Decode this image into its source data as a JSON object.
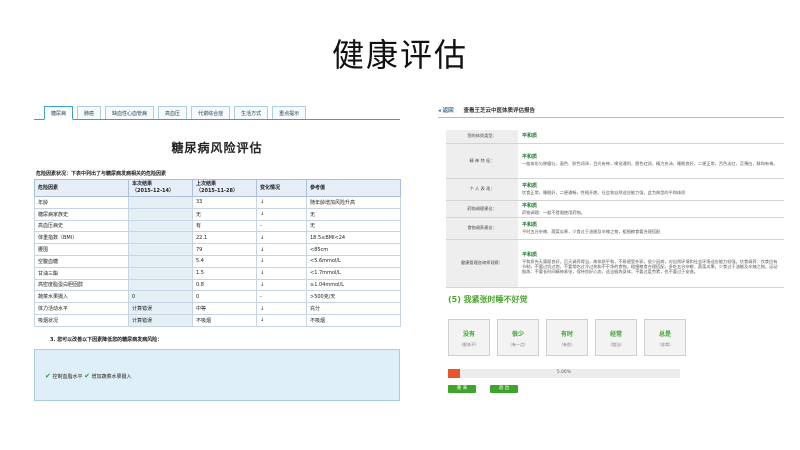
{
  "slide": {
    "title": "健康评估"
  },
  "left": {
    "tabs": [
      "糖尿病",
      "肺癌",
      "缺血性心血管病",
      "高血压",
      "代谢综合症",
      "生活方式",
      "重点提示"
    ],
    "panel_title": "糖尿病风险评估",
    "factor_hint": "危险因素状况：下表中列出了与糖尿病发病相关的危险因素",
    "table": {
      "headers": [
        "危险因素",
        "本次结果\n（2015-12-14）",
        "上次结果\n（2015-11-28）",
        "变化情况",
        "参考值"
      ],
      "rows": [
        [
          "年龄",
          "",
          "33",
          "↓",
          "随年龄增加风险升高"
        ],
        [
          "糖尿病家族史",
          "",
          "无",
          "↓",
          "无"
        ],
        [
          "高血压病史",
          "",
          "有",
          "-",
          "无"
        ],
        [
          "体重指数（BMI）",
          "",
          "22.1",
          "↓",
          "18.5≤BMI<24"
        ],
        [
          "腰围",
          "",
          "79",
          "↓",
          "<85cm"
        ],
        [
          "空腹血糖",
          "",
          "5.4",
          "↓",
          "<5.6mmol/L"
        ],
        [
          "甘油三酯",
          "",
          "1.5",
          "↓",
          "<1.7mmol/L"
        ],
        [
          "高密度脂蛋白胆固醇",
          "",
          "0.8",
          "↓",
          "≥1.04mmol/L"
        ],
        [
          "蔬菜水果摄入",
          "0",
          "0",
          "-",
          ">500克/天"
        ],
        [
          "体力活动水平",
          "计算错误",
          "中等",
          "↓",
          "充分"
        ],
        [
          "吸烟状况",
          "计算错误",
          "不吸烟",
          "↓",
          "不吸烟"
        ]
      ]
    },
    "advice_hint": "3. 您可以改善以下因素降低您的糖尿病发病风险：",
    "advice_items": [
      "控制血脂水平",
      "增加蔬菜水果摄入"
    ]
  },
  "right": {
    "back": "◂ 返回",
    "title": "查看王芝云中医体质评估报告",
    "rows": [
      {
        "label": "您的体质类型：",
        "type": "平和质",
        "text": ""
      },
      {
        "label": "精 神 特 征：",
        "type": "平和质",
        "text": "一般体形匀称健壮，面色、肤色润泽，目光有神，嗅觉通利，唇色红润，精力充沛，睡眠良好，二便正常，舌色淡红，苔薄白，脉和有神。"
      },
      {
        "label": "个 人 表 现：",
        "type": "平和质",
        "text": "饮食正常，睡眠好，二便通畅，性格开朗，社会和自然适应能力强，此为典型的平和体质"
      },
      {
        "label": "药物调理建议：",
        "type": "平和质",
        "text": "药物调理：一般不提倡使用药物。"
      },
      {
        "label": "食物调养建议：",
        "type": "平和质",
        "text": "平时五谷杂粮、蔬菜瓜果，少食过于油腻及辛辣之物，粗细粮食要合理搭配"
      },
      {
        "label": "健康管理咨询师观察：",
        "type": "平和质",
        "text": "平和质先天禀赋良好，后天调养得当，故体质平和，不易感受外邪，很少因病，对自然环境和社会环境适应能力较强。饮食调养：饮食应有节制，不要过饥过饱，不要常吃过冷过热和不干净的食物。粗细粮食合理搭配，多吃五谷杂粮、蔬菜瓜果，少食过于油腻及辛辣之物。运动锻炼：不要长时间精神紧张，保持良好心态，适当锻炼身体；不要过度劳累，也不要过于安逸。"
      }
    ]
  },
  "quiz": {
    "question": "(5) 我紧张时睡不好觉",
    "options": [
      {
        "label": "没有",
        "sub": "（根本不）"
      },
      {
        "label": "很少",
        "sub": "（有一点）"
      },
      {
        "label": "有时",
        "sub": "（有些）"
      },
      {
        "label": "经常",
        "sub": "（相当）"
      },
      {
        "label": "总是",
        "sub": "（非常）"
      }
    ],
    "progress_text": "5.06%",
    "progress_fraction": 0.0506,
    "buttons": [
      "重 来",
      "退 出"
    ],
    "accent": "#3ea42a"
  }
}
